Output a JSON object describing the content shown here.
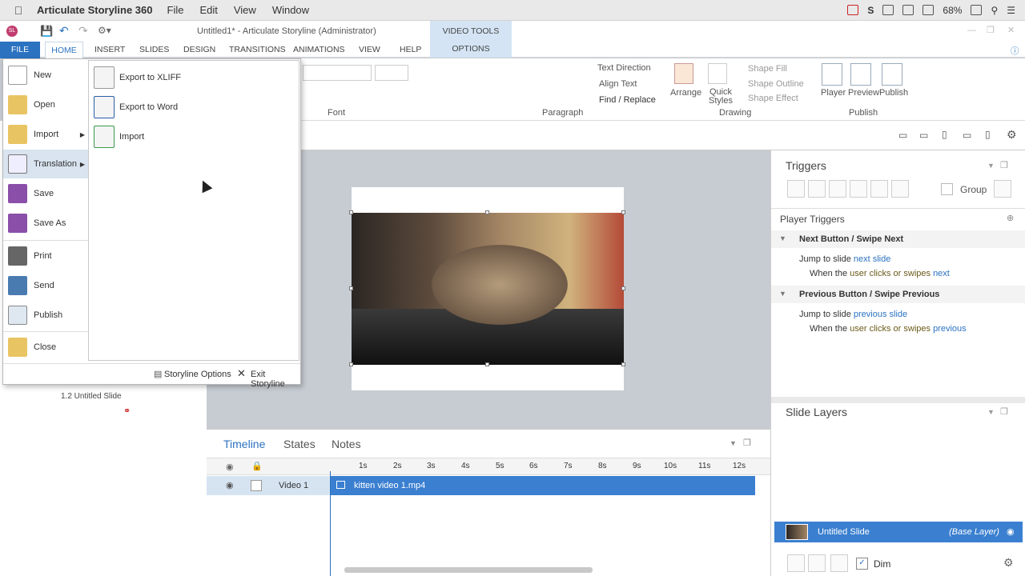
{
  "mac_menubar": {
    "app_name": "Articulate Storyline 360",
    "menus": [
      "File",
      "Edit",
      "View",
      "Window"
    ],
    "battery": "68%"
  },
  "window": {
    "title": "Untitled1* - Articulate Storyline (Administrator)",
    "logo_text": "SL"
  },
  "ribbon": {
    "contextual_group": "VIDEO TOOLS",
    "tabs": [
      "FILE",
      "HOME",
      "INSERT",
      "SLIDES",
      "DESIGN",
      "TRANSITIONS",
      "ANIMATIONS",
      "VIEW",
      "HELP",
      "OPTIONS"
    ],
    "groups": {
      "font": "Font",
      "paragraph": "Paragraph",
      "drawing": "Drawing",
      "publish": "Publish"
    },
    "buttons": {
      "text_direction": "Text Direction",
      "align_text": "Align Text",
      "find_replace": "Find / Replace",
      "arrange": "Arrange",
      "quick_styles": "Quick Styles",
      "shape_fill": "Shape Fill",
      "shape_outline": "Shape Outline",
      "shape_effect": "Shape Effect",
      "player": "Player",
      "preview": "Preview",
      "publish": "Publish"
    }
  },
  "file_menu": {
    "items": [
      {
        "label": "New"
      },
      {
        "label": "Open"
      },
      {
        "label": "Import"
      },
      {
        "label": "Translation"
      },
      {
        "label": "Save"
      },
      {
        "label": "Save As"
      },
      {
        "label": "Print"
      },
      {
        "label": "Send"
      },
      {
        "label": "Publish"
      },
      {
        "label": "Close"
      }
    ],
    "translation_submenu": [
      "Export to XLIFF",
      "Export to Word",
      "Import"
    ],
    "footer": {
      "options": "Storyline Options",
      "exit": "Exit Storyline"
    }
  },
  "scenes": {
    "slide_label": "1.2 Untitled Slide"
  },
  "timeline": {
    "tabs": [
      "Timeline",
      "States",
      "Notes"
    ],
    "ticks": [
      "1s",
      "2s",
      "3s",
      "4s",
      "5s",
      "6s",
      "7s",
      "8s",
      "9s",
      "10s",
      "11s",
      "12s"
    ],
    "row_name": "Video 1",
    "clip_name": "kitten video 1.mp4"
  },
  "triggers": {
    "title": "Triggers",
    "group_label": "Group",
    "section": "Player Triggers",
    "items": [
      {
        "name": "Next Button / Swipe Next",
        "action": "Jump to slide ",
        "target": "next slide",
        "cond_prefix": "When the ",
        "cond_subject": "user clicks or swipes ",
        "cond_object": "next"
      },
      {
        "name": "Previous Button / Swipe Previous",
        "action": "Jump to slide ",
        "target": "previous slide",
        "cond_prefix": "When the ",
        "cond_subject": "user clicks or swipes ",
        "cond_object": "previous"
      }
    ]
  },
  "layers": {
    "title": "Slide Layers",
    "base_layer_name": "Untitled Slide",
    "base_layer_tag": "(Base Layer)",
    "dim_label": "Dim"
  },
  "colors": {
    "accent": "#2b72c0",
    "selection": "#3a7fd0",
    "canvas": "#c6ccd2"
  }
}
